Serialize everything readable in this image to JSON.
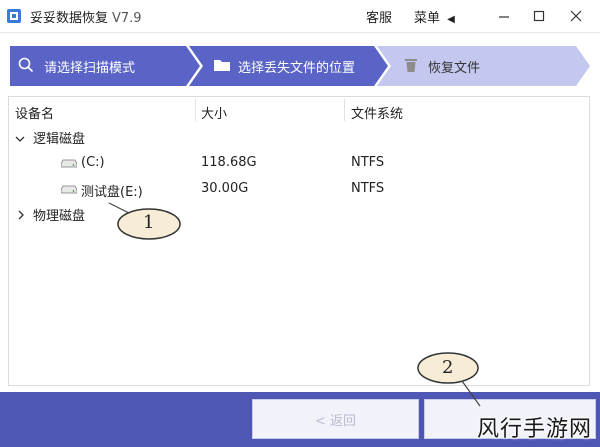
{
  "titlebar": {
    "app_name": "妥妥数据恢复",
    "version": "V7.9",
    "support_label": "客服",
    "menu_label": "菜单",
    "menu_arrow": "◀"
  },
  "wizard": {
    "steps": [
      {
        "label": "请选择扫描模式"
      },
      {
        "label": "选择丢失文件的位置"
      },
      {
        "label": "恢复文件"
      }
    ]
  },
  "device_table": {
    "columns": [
      "设备名",
      "大小",
      "文件系统"
    ],
    "groups": [
      {
        "label": "逻辑磁盘",
        "expanded": true,
        "items": [
          {
            "name": "(C:)",
            "size": "118.68G",
            "fs": "NTFS"
          },
          {
            "name": "测试盘(E:)",
            "size": "30.00G",
            "fs": "NTFS"
          }
        ]
      },
      {
        "label": "物理磁盘",
        "expanded": false
      }
    ]
  },
  "bottombar": {
    "back_label": "< 返回",
    "next_label": ""
  },
  "callouts": [
    "1",
    "2"
  ],
  "watermark": "风行手游网",
  "colors": {
    "step_active": "#5a63c6",
    "step_inactive": "#c4c7ee",
    "bottombar": "#4f57b5"
  }
}
